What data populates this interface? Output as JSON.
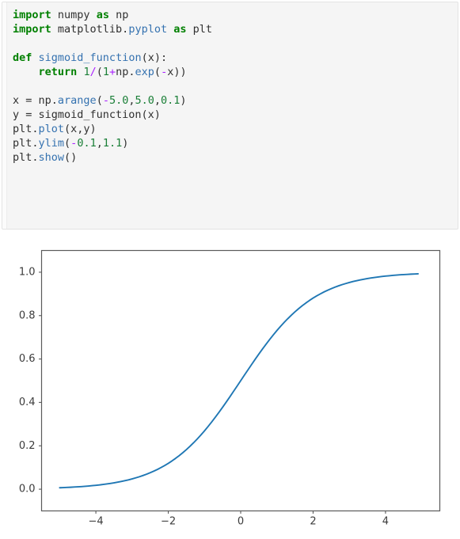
{
  "code_cell": {
    "language": "python",
    "background": "#f5f5f5",
    "lines": [
      [
        {
          "t": "import",
          "c": "kw"
        },
        {
          "t": " numpy ",
          "c": "pl"
        },
        {
          "t": "as",
          "c": "kw"
        },
        {
          "t": " np",
          "c": "pl"
        }
      ],
      [
        {
          "t": "import",
          "c": "kw"
        },
        {
          "t": " matplotlib.",
          "c": "pl"
        },
        {
          "t": "pyplot",
          "c": "mod"
        },
        {
          "t": " ",
          "c": "pl"
        },
        {
          "t": "as",
          "c": "kw"
        },
        {
          "t": " plt",
          "c": "pl"
        }
      ],
      [],
      [
        {
          "t": "def",
          "c": "kw"
        },
        {
          "t": " ",
          "c": "pl"
        },
        {
          "t": "sigmoid_function",
          "c": "fn"
        },
        {
          "t": "(x):",
          "c": "pl"
        }
      ],
      [
        {
          "t": "    ",
          "c": "pl"
        },
        {
          "t": "return",
          "c": "kw"
        },
        {
          "t": " ",
          "c": "pl"
        },
        {
          "t": "1",
          "c": "num"
        },
        {
          "t": "/",
          "c": "op"
        },
        {
          "t": "(",
          "c": "pl"
        },
        {
          "t": "1",
          "c": "num"
        },
        {
          "t": "+",
          "c": "op"
        },
        {
          "t": "np.",
          "c": "pl"
        },
        {
          "t": "exp",
          "c": "fn"
        },
        {
          "t": "(",
          "c": "pl"
        },
        {
          "t": "-",
          "c": "op"
        },
        {
          "t": "x))",
          "c": "pl"
        }
      ],
      [],
      [
        {
          "t": "x = np.",
          "c": "pl"
        },
        {
          "t": "arange",
          "c": "fn"
        },
        {
          "t": "(",
          "c": "pl"
        },
        {
          "t": "-",
          "c": "op"
        },
        {
          "t": "5.0",
          "c": "num"
        },
        {
          "t": ",",
          "c": "pl"
        },
        {
          "t": "5.0",
          "c": "num"
        },
        {
          "t": ",",
          "c": "pl"
        },
        {
          "t": "0.1",
          "c": "num"
        },
        {
          "t": ")",
          "c": "pl"
        }
      ],
      [
        {
          "t": "y = sigmoid_function(x)",
          "c": "pl"
        }
      ],
      [
        {
          "t": "plt.",
          "c": "pl"
        },
        {
          "t": "plot",
          "c": "fn"
        },
        {
          "t": "(x,y)",
          "c": "pl"
        }
      ],
      [
        {
          "t": "plt.",
          "c": "pl"
        },
        {
          "t": "ylim",
          "c": "fn"
        },
        {
          "t": "(",
          "c": "pl"
        },
        {
          "t": "-",
          "c": "op"
        },
        {
          "t": "0.1",
          "c": "num"
        },
        {
          "t": ",",
          "c": "pl"
        },
        {
          "t": "1.1",
          "c": "num"
        },
        {
          "t": ")",
          "c": "pl"
        }
      ],
      [
        {
          "t": "plt.",
          "c": "pl"
        },
        {
          "t": "show",
          "c": "fn"
        },
        {
          "t": "()",
          "c": "pl"
        }
      ]
    ],
    "plain_text": "import numpy as np\nimport matplotlib.pyplot as plt\n\ndef sigmoid_function(x):\n    return 1/(1+np.exp(-x))\n\nx = np.arange(-5.0,5.0,0.1)\ny = sigmoid_function(x)\nplt.plot(x,y)\nplt.ylim(-0.1,1.1)\nplt.show()"
  },
  "chart_data": {
    "type": "line",
    "title": "",
    "xlabel": "",
    "ylabel": "",
    "xlim": [
      -5.5,
      5.5
    ],
    "ylim": [
      -0.1,
      1.1
    ],
    "grid": false,
    "legend": false,
    "line_color": "#1f77b4",
    "line_width": 1.9,
    "xticks": [
      -4,
      -2,
      0,
      2,
      4
    ],
    "xtick_labels": [
      "−4",
      "−2",
      "0",
      "2",
      "4"
    ],
    "yticks": [
      0.0,
      0.2,
      0.4,
      0.6,
      0.8,
      1.0
    ],
    "ytick_labels": [
      "0.0",
      "0.2",
      "0.4",
      "0.6",
      "0.8",
      "1.0"
    ],
    "series": [
      {
        "name": "sigmoid_function(x)",
        "x": [
          -5.0,
          -4.9,
          -4.8,
          -4.7,
          -4.6,
          -4.5,
          -4.4,
          -4.3,
          -4.2,
          -4.1,
          -4.0,
          -3.9,
          -3.8,
          -3.7,
          -3.6,
          -3.5,
          -3.4,
          -3.3,
          -3.2,
          -3.1,
          -3.0,
          -2.9,
          -2.8,
          -2.7,
          -2.6,
          -2.5,
          -2.4,
          -2.3,
          -2.2,
          -2.1,
          -2.0,
          -1.9,
          -1.8,
          -1.7,
          -1.6,
          -1.5,
          -1.4,
          -1.3,
          -1.2,
          -1.1,
          -1.0,
          -0.9,
          -0.8,
          -0.7,
          -0.6,
          -0.5,
          -0.4,
          -0.3,
          -0.2,
          -0.1,
          0.0,
          0.1,
          0.2,
          0.3,
          0.4,
          0.5,
          0.6,
          0.7,
          0.8,
          0.9,
          1.0,
          1.1,
          1.2,
          1.3,
          1.4,
          1.5,
          1.6,
          1.7,
          1.8,
          1.9,
          2.0,
          2.1,
          2.2,
          2.3,
          2.4,
          2.5,
          2.6,
          2.7,
          2.8,
          2.9,
          3.0,
          3.1,
          3.2,
          3.3,
          3.4,
          3.5,
          3.6,
          3.7,
          3.8,
          3.9,
          4.0,
          4.1,
          4.2,
          4.3,
          4.4,
          4.5,
          4.6,
          4.7,
          4.8,
          4.9
        ],
        "y": [
          0.0067,
          0.0074,
          0.0082,
          0.009,
          0.01,
          0.011,
          0.0121,
          0.0134,
          0.0148,
          0.0163,
          0.018,
          0.0198,
          0.0219,
          0.0241,
          0.0266,
          0.0293,
          0.0323,
          0.0356,
          0.0392,
          0.0431,
          0.0474,
          0.0522,
          0.0573,
          0.063,
          0.0691,
          0.0759,
          0.0832,
          0.0911,
          0.0998,
          0.1091,
          0.1192,
          0.1301,
          0.1419,
          0.1545,
          0.168,
          0.1824,
          0.1978,
          0.2142,
          0.2315,
          0.2497,
          0.2689,
          0.2891,
          0.31,
          0.3318,
          0.3543,
          0.3775,
          0.4013,
          0.4256,
          0.4502,
          0.475,
          0.5,
          0.525,
          0.5498,
          0.5744,
          0.5987,
          0.6225,
          0.6457,
          0.6682,
          0.69,
          0.7109,
          0.7311,
          0.7503,
          0.7685,
          0.7858,
          0.8022,
          0.8176,
          0.832,
          0.8455,
          0.8581,
          0.8699,
          0.8808,
          0.8909,
          0.9002,
          0.9089,
          0.9168,
          0.9241,
          0.9309,
          0.937,
          0.9427,
          0.9478,
          0.9526,
          0.9569,
          0.9608,
          0.9644,
          0.9677,
          0.9707,
          0.9734,
          0.9759,
          0.9781,
          0.9802,
          0.982,
          0.9837,
          0.9852,
          0.9866,
          0.9879,
          0.989,
          0.99,
          0.991,
          0.9918,
          0.9926
        ]
      }
    ]
  }
}
